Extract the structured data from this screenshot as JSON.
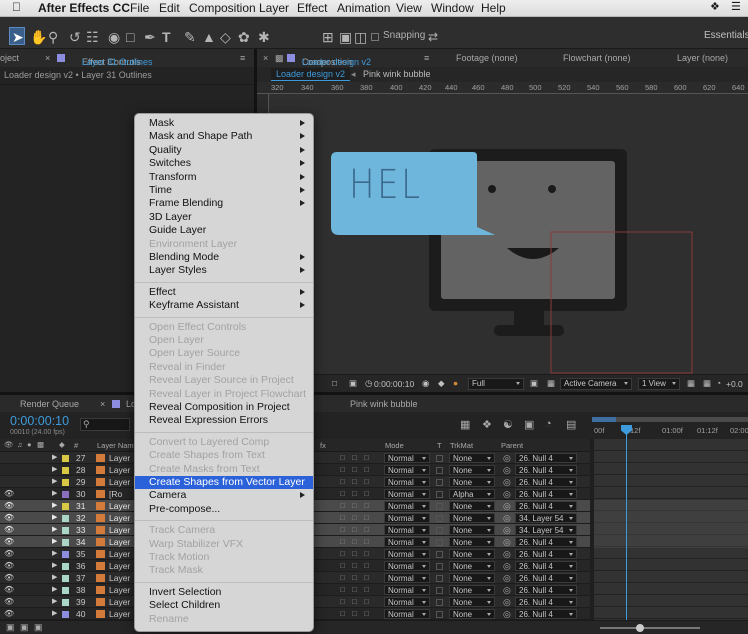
{
  "menubar": {
    "app_name": "After Effects CC",
    "items": [
      "File",
      "Edit",
      "Composition",
      "Layer",
      "Effect",
      "Animation",
      "View",
      "Window",
      "Help"
    ]
  },
  "toolbar": {
    "snapping_label": "Snapping",
    "workspace_label": "Essentials"
  },
  "left_panel": {
    "tab_fragment": "oject",
    "effect_controls_label": "Effect Controls",
    "effect_controls_layer": "Layer 31 Outlines",
    "breadcrumb": "Loader design v2 • Layer 31 Outlines"
  },
  "comp_panel": {
    "tab_label": "Composition",
    "comp_name": "Loader design v2",
    "footage_tab": "Footage (none)",
    "flowchart_tab": "Flowchart (none)",
    "layer_tab": "Layer (none)",
    "subtab_active": "Loader design v2",
    "subtab_other": "Pink wink bubble",
    "ruler_ticks": [
      "320",
      "340",
      "360",
      "380",
      "400",
      "420",
      "440",
      "460",
      "480",
      "500",
      "520",
      "540",
      "560",
      "580",
      "600",
      "620",
      "640",
      "660"
    ],
    "speech_text": "HEL",
    "footer": {
      "timecode": "0:00:00:10",
      "resolution": "Full",
      "camera": "Active Camera",
      "views": "1 View",
      "offset": "+0.0"
    }
  },
  "context_menu": {
    "items": [
      {
        "label": "Mask",
        "submenu": true,
        "disabled": false
      },
      {
        "label": "Mask and Shape Path",
        "submenu": true,
        "disabled": false
      },
      {
        "label": "Quality",
        "submenu": true,
        "disabled": false
      },
      {
        "label": "Switches",
        "submenu": true,
        "disabled": false
      },
      {
        "label": "Transform",
        "submenu": true,
        "disabled": false
      },
      {
        "label": "Time",
        "submenu": true,
        "disabled": false
      },
      {
        "label": "Frame Blending",
        "submenu": true,
        "disabled": false
      },
      {
        "label": "3D Layer",
        "submenu": false,
        "disabled": false
      },
      {
        "label": "Guide Layer",
        "submenu": false,
        "disabled": false
      },
      {
        "label": "Environment Layer",
        "submenu": false,
        "disabled": true
      },
      {
        "label": "Blending Mode",
        "submenu": true,
        "disabled": false
      },
      {
        "label": "Layer Styles",
        "submenu": true,
        "disabled": false
      },
      {
        "separator": true
      },
      {
        "label": "Effect",
        "submenu": true,
        "disabled": false
      },
      {
        "label": "Keyframe Assistant",
        "submenu": true,
        "disabled": false
      },
      {
        "separator": true
      },
      {
        "label": "Open Effect Controls",
        "submenu": false,
        "disabled": true
      },
      {
        "label": "Open Layer",
        "submenu": false,
        "disabled": true
      },
      {
        "label": "Open Layer Source",
        "submenu": false,
        "disabled": true
      },
      {
        "label": "Reveal in Finder",
        "submenu": false,
        "disabled": true
      },
      {
        "label": "Reveal Layer Source in Project",
        "submenu": false,
        "disabled": true
      },
      {
        "label": "Reveal Layer in Project Flowchart",
        "submenu": false,
        "disabled": true
      },
      {
        "label": "Reveal Composition in Project",
        "submenu": false,
        "disabled": false
      },
      {
        "label": "Reveal Expression Errors",
        "submenu": false,
        "disabled": false
      },
      {
        "separator": true
      },
      {
        "label": "Convert to Layered Comp",
        "submenu": false,
        "disabled": true
      },
      {
        "label": "Create Shapes from Text",
        "submenu": false,
        "disabled": true
      },
      {
        "label": "Create Masks from Text",
        "submenu": false,
        "disabled": true
      },
      {
        "label": "Create Shapes from Vector Layer",
        "submenu": false,
        "disabled": false,
        "selected": true
      },
      {
        "label": "Camera",
        "submenu": true,
        "disabled": false
      },
      {
        "label": "Pre-compose...",
        "submenu": false,
        "disabled": false
      },
      {
        "separator": true
      },
      {
        "label": "Track Camera",
        "submenu": false,
        "disabled": true
      },
      {
        "label": "Warp Stabilizer VFX",
        "submenu": false,
        "disabled": true
      },
      {
        "label": "Track Motion",
        "submenu": false,
        "disabled": true
      },
      {
        "label": "Track Mask",
        "submenu": false,
        "disabled": true
      },
      {
        "separator": true
      },
      {
        "label": "Invert Selection",
        "submenu": false,
        "disabled": false
      },
      {
        "label": "Select Children",
        "submenu": false,
        "disabled": false
      },
      {
        "label": "Rename",
        "submenu": false,
        "disabled": true
      }
    ]
  },
  "timeline": {
    "render_queue_tab": "Render Queue",
    "tab_fragment": "Lo",
    "pink_tab": "Pink wink bubble",
    "timecode": "0:00:00:10",
    "timecode_sub": "00010 (24.00 fps)",
    "columns": {
      "num": "#",
      "layer_name": "Layer Name",
      "mode": "Mode",
      "t": "T",
      "trkmat": "TrkMat",
      "parent": "Parent"
    },
    "ruler": [
      "00f",
      "12f",
      "01:00f",
      "01:12f",
      "02:00"
    ],
    "rows": [
      {
        "num": "27",
        "name": "Layer",
        "color": "#d8c844",
        "mode": "Normal",
        "trkmat": "None",
        "parent": "26. Null 4",
        "selected": false,
        "visible": false
      },
      {
        "num": "28",
        "name": "Layer",
        "color": "#d8c844",
        "mode": "Normal",
        "trkmat": "None",
        "parent": "26. Null 4",
        "selected": false,
        "visible": false
      },
      {
        "num": "29",
        "name": "Layer",
        "color": "#d8c844",
        "mode": "Normal",
        "trkmat": "None",
        "parent": "26. Null 4",
        "selected": false,
        "visible": false
      },
      {
        "num": "30",
        "name": "[Ro",
        "color": "#8a6fbf",
        "mode": "Normal",
        "trkmat": "Alpha",
        "parent": "26. Null 4",
        "selected": false,
        "visible": true
      },
      {
        "num": "31",
        "name": "Layer",
        "color": "#d8c844",
        "mode": "Normal",
        "trkmat": "None",
        "parent": "26. Null 4",
        "selected": true,
        "visible": true
      },
      {
        "num": "32",
        "name": "Layer",
        "color": "#a9d6c8",
        "mode": "Normal",
        "trkmat": "None",
        "parent": "34. Layer 54",
        "selected": true,
        "visible": true
      },
      {
        "num": "33",
        "name": "Layer",
        "color": "#a9d6c8",
        "mode": "Normal",
        "trkmat": "None",
        "parent": "34. Layer 54",
        "selected": true,
        "visible": true
      },
      {
        "num": "34",
        "name": "Layer",
        "color": "#a9d6c8",
        "mode": "Normal",
        "trkmat": "None",
        "parent": "26. Null 4",
        "selected": true,
        "visible": true
      },
      {
        "num": "35",
        "name": "Layer",
        "color": "#8d8de0",
        "mode": "Normal",
        "trkmat": "None",
        "parent": "26. Null 4",
        "selected": false,
        "visible": true
      },
      {
        "num": "36",
        "name": "Layer",
        "color": "#a9d6c8",
        "mode": "Normal",
        "trkmat": "None",
        "parent": "26. Null 4",
        "selected": false,
        "visible": true
      },
      {
        "num": "37",
        "name": "Layer",
        "color": "#a9d6c8",
        "mode": "Normal",
        "trkmat": "None",
        "parent": "26. Null 4",
        "selected": false,
        "visible": true
      },
      {
        "num": "38",
        "name": "Layer",
        "color": "#a9d6c8",
        "mode": "Normal",
        "trkmat": "None",
        "parent": "26. Null 4",
        "selected": false,
        "visible": true
      },
      {
        "num": "39",
        "name": "Layer",
        "color": "#a9d6c8",
        "mode": "Normal",
        "trkmat": "None",
        "parent": "26. Null 4",
        "selected": false,
        "visible": true
      },
      {
        "num": "40",
        "name": "Layer",
        "color": "#8d8de0",
        "mode": "Normal",
        "trkmat": "None",
        "parent": "26. Null 4",
        "selected": false,
        "visible": true
      }
    ]
  },
  "colors": {
    "accent_blue": "#3d9bdc",
    "menu_highlight": "#2b62d9",
    "speech_bubble": "#6fb6dc",
    "monitor": "#636363"
  }
}
